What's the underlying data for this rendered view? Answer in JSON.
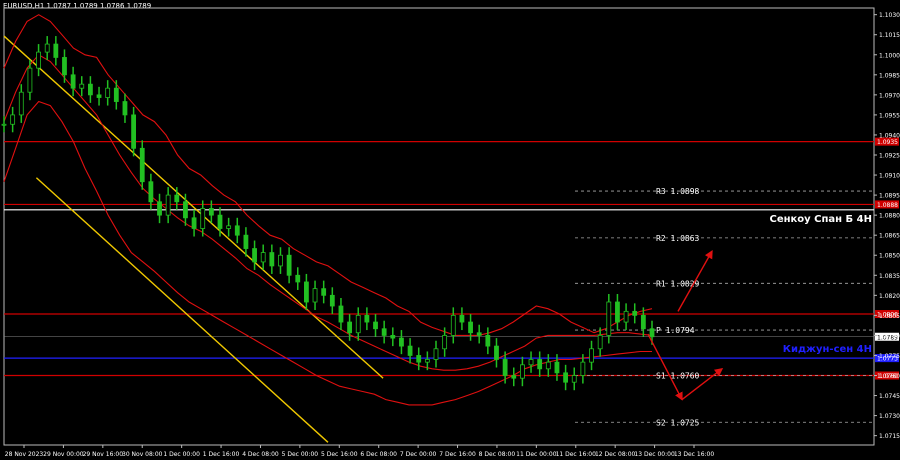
{
  "header": {
    "symbol_line": "EURUSD,H1  1.0787 1.0789 1.0786 1.0789"
  },
  "chart_data": {
    "type": "line",
    "symbol": "EURUSD",
    "timeframe": "H1",
    "ohlc": {
      "open": 1.0787,
      "high": 1.0789,
      "low": 1.0786,
      "close": 1.0789
    },
    "ylim": [
      1.0708,
      1.1035
    ],
    "y_ticks": [
      "1.1030",
      "1.1015",
      "1.1000",
      "1.0985",
      "1.0970",
      "1.0955",
      "1.0940",
      "1.0925",
      "1.0910",
      "1.0895",
      "1.0880",
      "1.0865",
      "1.0850",
      "1.0835",
      "1.0820",
      "1.0805",
      "1.0790",
      "1.0775",
      "1.0760",
      "1.0745",
      "1.0730",
      "1.0715"
    ],
    "x_ticks": [
      "28 Nov 2023",
      "29 Nov 00:00",
      "29 Nov 16:00",
      "30 Nov 08:00",
      "1 Dec 00:00",
      "1 Dec 16:00",
      "4 Dec 08:00",
      "5 Dec 00:00",
      "5 Dec 16:00",
      "6 Dec 08:00",
      "7 Dec 00:00",
      "7 Dec 16:00",
      "8 Dec 08:00",
      "11 Dec 00:00",
      "11 Dec 16:00",
      "12 Dec 08:00",
      "13 Dec 00:00",
      "13 Dec 16:00"
    ],
    "current_price": {
      "value": 1.0789,
      "label": "1.0789"
    },
    "horizontal_levels": [
      {
        "value": 1.0935,
        "label": "1.0935",
        "color": "#d00000"
      },
      {
        "value": 1.0888,
        "label": "1.0888",
        "color": "#d00000"
      },
      {
        "value": 1.0884,
        "label": "",
        "color": "#ffffff"
      },
      {
        "value": 1.0806,
        "label": "1.0806",
        "color": "#d00000"
      },
      {
        "value": 1.0773,
        "label": "1.0773",
        "color": "#2020ff"
      },
      {
        "value": 1.076,
        "label": "1.0760",
        "color": "#d00000"
      }
    ],
    "pivot_levels": [
      {
        "name": "R3",
        "value": 1.0898,
        "text": "R3 1.0898"
      },
      {
        "name": "R2",
        "value": 1.0863,
        "text": "R2 1.0863"
      },
      {
        "name": "R1",
        "value": 1.0829,
        "text": "R1 1.0829"
      },
      {
        "name": "P",
        "value": 1.0794,
        "text": "P 1.0794"
      },
      {
        "name": "S1",
        "value": 1.076,
        "text": "S1 1.0760"
      },
      {
        "name": "S2",
        "value": 1.0725,
        "text": "S2 1.0725"
      }
    ],
    "level_labels": [
      {
        "text": "Сенкоу Спан Б 4Н",
        "value": 1.0877,
        "color": "#ffffff"
      },
      {
        "text": "Киджун-сен 4Н",
        "value": 1.078,
        "color": "#2020ff"
      }
    ],
    "price_series": [
      1.0948,
      1.0955,
      1.0972,
      1.099,
      1.1002,
      1.1008,
      1.0998,
      1.0985,
      1.0975,
      1.0978,
      1.097,
      1.0968,
      1.0975,
      1.0965,
      1.0955,
      1.093,
      1.0905,
      1.089,
      1.088,
      1.0895,
      1.089,
      1.0878,
      1.087,
      1.0885,
      1.088,
      1.087,
      1.0872,
      1.0865,
      1.0855,
      1.0845,
      1.0852,
      1.0842,
      1.085,
      1.0835,
      1.083,
      1.0815,
      1.0825,
      1.082,
      1.0812,
      1.08,
      1.0792,
      1.0805,
      1.08,
      1.0795,
      1.079,
      1.0788,
      1.0782,
      1.0775,
      1.077,
      1.0772,
      1.078,
      1.079,
      1.0805,
      1.08,
      1.0792,
      1.079,
      1.0782,
      1.0772,
      1.076,
      1.0758,
      1.0768,
      1.0772,
      1.0765,
      1.077,
      1.0762,
      1.0755,
      1.076,
      1.077,
      1.078,
      1.079,
      1.0815,
      1.08,
      1.0808,
      1.0805,
      1.0795,
      1.0789
    ],
    "bollinger_upper": [
      1.099,
      1.101,
      1.1025,
      1.103,
      1.1025,
      1.1015,
      1.1005,
      1.1,
      1.0998,
      1.0985,
      1.0975,
      1.0965,
      1.0955,
      1.095,
      1.094,
      1.0925,
      1.0915,
      1.091,
      1.0902,
      1.0895,
      1.089,
      1.088,
      1.0872,
      1.0865,
      1.0862,
      1.0855,
      1.085,
      1.0845,
      1.0842,
      1.0836,
      1.083,
      1.0826,
      1.0822,
      1.0818,
      1.0812,
      1.0808,
      1.08,
      1.0796,
      1.0793,
      1.079,
      1.079,
      1.079,
      1.0792,
      1.0795,
      1.08,
      1.0806,
      1.0812,
      1.081,
      1.0806,
      1.08,
      1.0796,
      1.0792,
      1.0795,
      1.08,
      1.0805,
      1.0808,
      1.081
    ],
    "bollinger_mid": [
      1.095,
      1.0972,
      1.099,
      1.1,
      1.0995,
      1.0985,
      1.0975,
      1.0965,
      1.0955,
      1.094,
      1.0925,
      1.0912,
      1.09,
      1.0892,
      1.0885,
      1.0878,
      1.0872,
      1.0868,
      1.0862,
      1.0855,
      1.0848,
      1.084,
      1.0835,
      1.0828,
      1.0822,
      1.0816,
      1.081,
      1.0804,
      1.08,
      1.0795,
      1.079,
      1.0786,
      1.0782,
      1.0778,
      1.0774,
      1.077,
      1.0767,
      1.0765,
      1.0764,
      1.0764,
      1.0765,
      1.0767,
      1.077,
      1.0774,
      1.0778,
      1.0782,
      1.0788,
      1.079,
      1.079,
      1.079,
      1.079,
      1.079,
      1.0791,
      1.0792,
      1.0792,
      1.0791,
      1.079
    ],
    "bollinger_lower": [
      1.0905,
      1.093,
      1.0955,
      1.0965,
      1.0962,
      1.095,
      1.0935,
      1.0915,
      1.0898,
      1.088,
      1.0865,
      1.0852,
      1.0845,
      1.0838,
      1.083,
      1.0822,
      1.0815,
      1.081,
      1.0805,
      1.08,
      1.0795,
      1.079,
      1.0785,
      1.078,
      1.0775,
      1.077,
      1.0765,
      1.076,
      1.0756,
      1.0752,
      1.075,
      1.0748,
      1.0746,
      1.0742,
      1.074,
      1.0738,
      1.0738,
      1.0738,
      1.074,
      1.0742,
      1.0745,
      1.0748,
      1.0752,
      1.0756,
      1.076,
      1.0765,
      1.0768,
      1.077,
      1.0772,
      1.0772,
      1.0773,
      1.0774,
      1.0775,
      1.0776,
      1.0777,
      1.0778,
      1.0778
    ],
    "channel_upper": {
      "x": [
        0.0,
        0.585
      ],
      "y": [
        1.1014,
        1.0758
      ]
    },
    "channel_lower": {
      "x": [
        0.05,
        0.5
      ],
      "y": [
        1.0908,
        1.071
      ]
    },
    "forecast_arrows": [
      {
        "from": 1.0808,
        "to": 1.0853
      },
      {
        "from": 1.0791,
        "to": 1.0742
      },
      {
        "from": 1.0742,
        "to": 1.0765
      }
    ]
  }
}
